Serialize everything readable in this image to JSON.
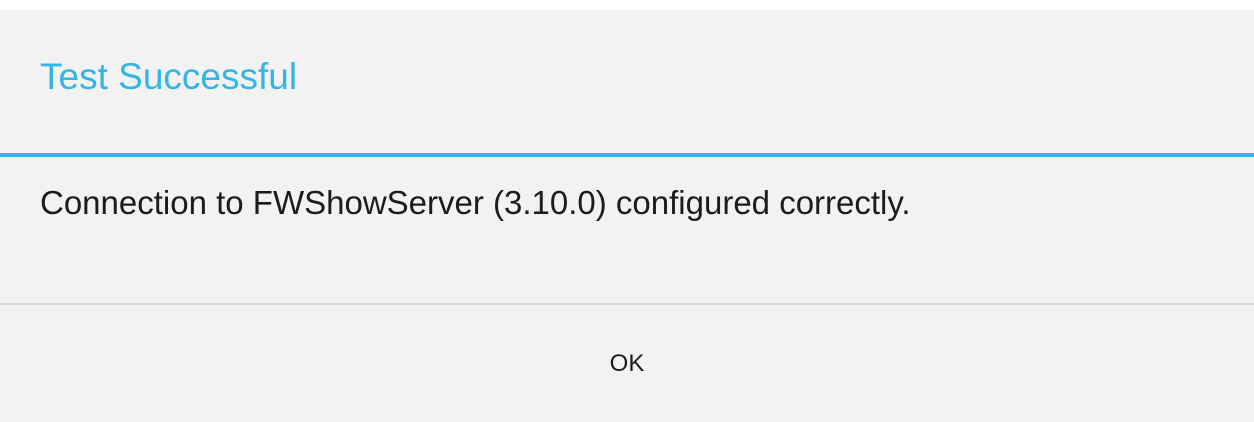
{
  "dialog": {
    "title": "Test Successful",
    "message": "Connection to FWShowServer (3.10.0) configured correctly.",
    "ok_label": "OK"
  },
  "colors": {
    "accent": "#33b5e5",
    "background": "#f2f2f2",
    "text": "#1c1c1c",
    "divider": "#d9d9d9"
  }
}
